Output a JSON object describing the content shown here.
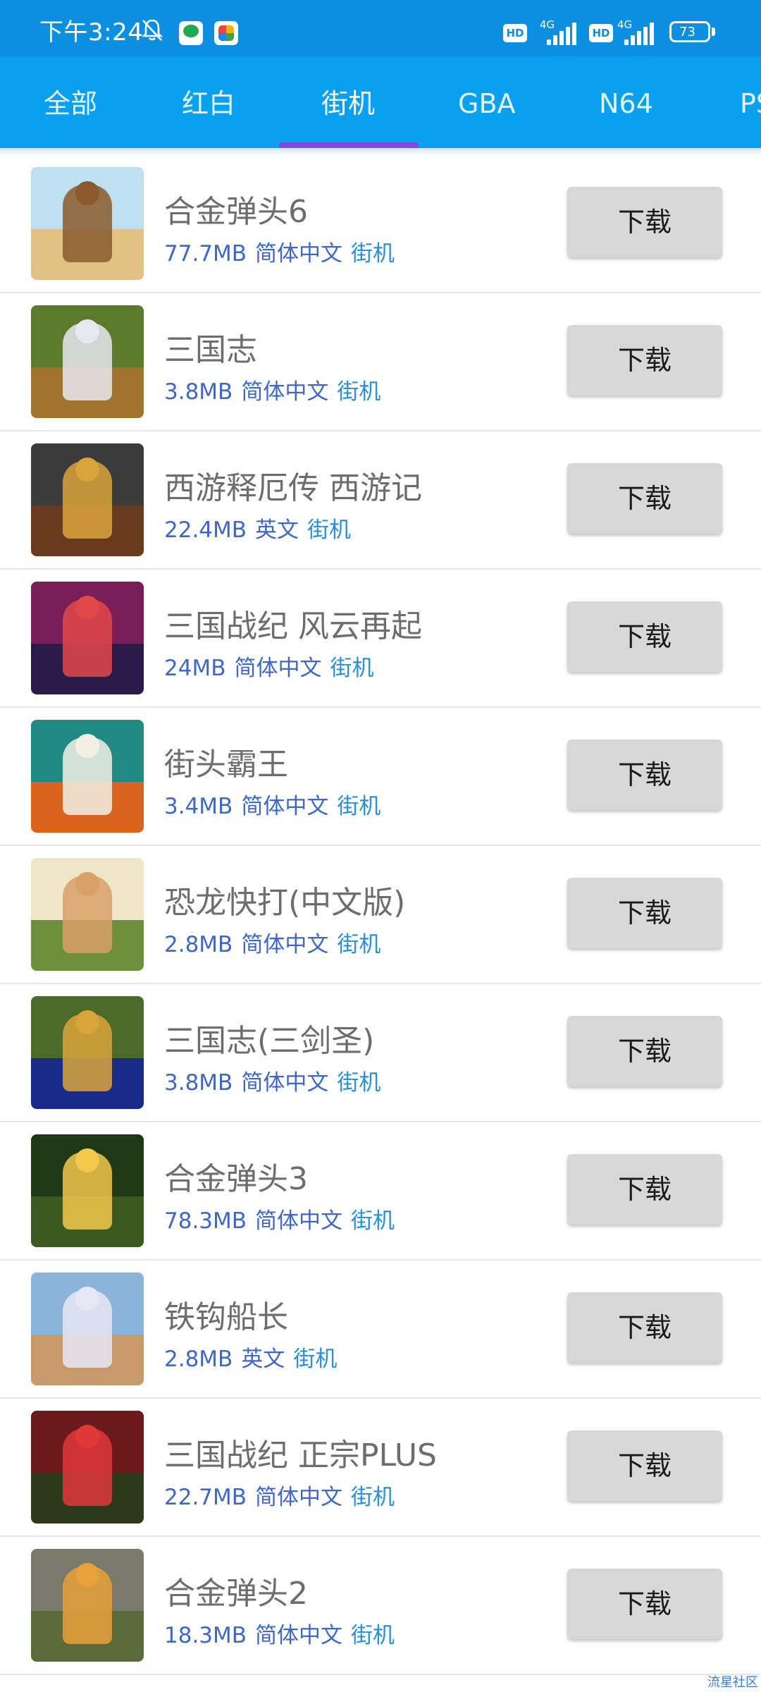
{
  "status_bar": {
    "time": "下午3:24",
    "hd1": "HD",
    "sig1": "4G",
    "hd2": "HD",
    "sig2": "4G",
    "battery": "73",
    "icons": [
      "mute-bell-icon",
      "app-notification-icon",
      "app-notification-icon"
    ]
  },
  "tabs": [
    {
      "label": "全部"
    },
    {
      "label": "红白"
    },
    {
      "label": "街机"
    },
    {
      "label": "GBA"
    },
    {
      "label": "N64"
    },
    {
      "label": "PS"
    }
  ],
  "active_tab": "街机",
  "accent_color": "#09a0ef",
  "indicator_color": "#7b4de0",
  "download_label": "下载",
  "games": [
    {
      "title": "合金弹头6",
      "size": "77.7MB",
      "lang": "简体中文",
      "category": "街机",
      "colors": [
        "#bfe0ef",
        "#e2c184",
        "#8a5a2b"
      ]
    },
    {
      "title": "三国志",
      "size": "3.8MB",
      "lang": "简体中文",
      "category": "街机",
      "colors": [
        "#5b7a2a",
        "#a0742f",
        "#e8e8f0"
      ]
    },
    {
      "title": "西游释厄传 西游记",
      "size": "22.4MB",
      "lang": "英文",
      "category": "街机",
      "colors": [
        "#3b3b3b",
        "#6a3a1e",
        "#d9a43a"
      ]
    },
    {
      "title": "三国战纪 风云再起",
      "size": "24MB",
      "lang": "简体中文",
      "category": "街机",
      "colors": [
        "#7a1e5a",
        "#2a1a4a",
        "#e04848"
      ]
    },
    {
      "title": "街头霸王",
      "size": "3.4MB",
      "lang": "简体中文",
      "category": "街机",
      "colors": [
        "#1f8a84",
        "#d8641e",
        "#f4f0e6"
      ]
    },
    {
      "title": "恐龙快打(中文版)",
      "size": "2.8MB",
      "lang": "简体中文",
      "category": "街机",
      "colors": [
        "#f0e6c8",
        "#6b8f3a",
        "#d9a06a"
      ]
    },
    {
      "title": "三国志(三剑圣)",
      "size": "3.8MB",
      "lang": "简体中文",
      "category": "街机",
      "colors": [
        "#4a6a2a",
        "#1a2a8a",
        "#d9a43a"
      ]
    },
    {
      "title": "合金弹头3",
      "size": "78.3MB",
      "lang": "简体中文",
      "category": "街机",
      "colors": [
        "#1e3a14",
        "#3a5a20",
        "#f4c84a"
      ]
    },
    {
      "title": "铁钩船长",
      "size": "2.8MB",
      "lang": "英文",
      "category": "街机",
      "colors": [
        "#8ab4d8",
        "#c89a6a",
        "#e8e8f4"
      ]
    },
    {
      "title": "三国战纪 正宗PLUS",
      "size": "22.7MB",
      "lang": "简体中文",
      "category": "街机",
      "colors": [
        "#6a1a1a",
        "#2a3a1a",
        "#e03838"
      ]
    },
    {
      "title": "合金弹头2",
      "size": "18.3MB",
      "lang": "简体中文",
      "category": "街机",
      "colors": [
        "#7a7a6a",
        "#5a6a3a",
        "#e8a03a"
      ]
    }
  ],
  "watermark": "流星社区"
}
